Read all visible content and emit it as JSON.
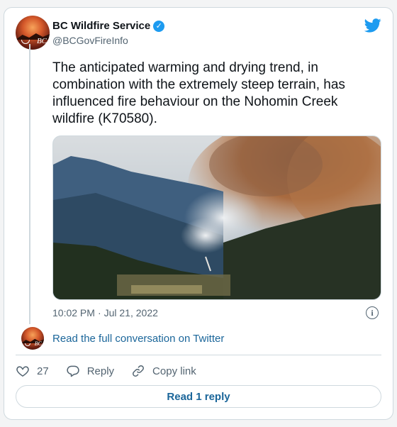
{
  "author": {
    "display_name": "BC Wildfire Service",
    "handle": "@BCGovFireInfo",
    "verified": true,
    "avatar_icon": "bc-wildfire-logo"
  },
  "tweet": {
    "text": "The anticipated warming and drying trend, in combination with the extremely steep terrain, has influenced fire behaviour on the Nohomin Creek wildfire (K70580).",
    "time": "10:02 PM",
    "separator": "·",
    "date": "Jul 21, 2022"
  },
  "conversation": {
    "link_label": "Read the full conversation on Twitter"
  },
  "actions": {
    "like_count": "27",
    "reply_label": "Reply",
    "copy_link_label": "Copy link"
  },
  "footer": {
    "read_reply_label": "Read 1 reply"
  },
  "colors": {
    "link_blue": "#1b669a",
    "verified_blue": "#1d9bf0",
    "twitter_blue": "#1d9bf0",
    "muted_text": "#536471",
    "border": "#cfd9de"
  }
}
